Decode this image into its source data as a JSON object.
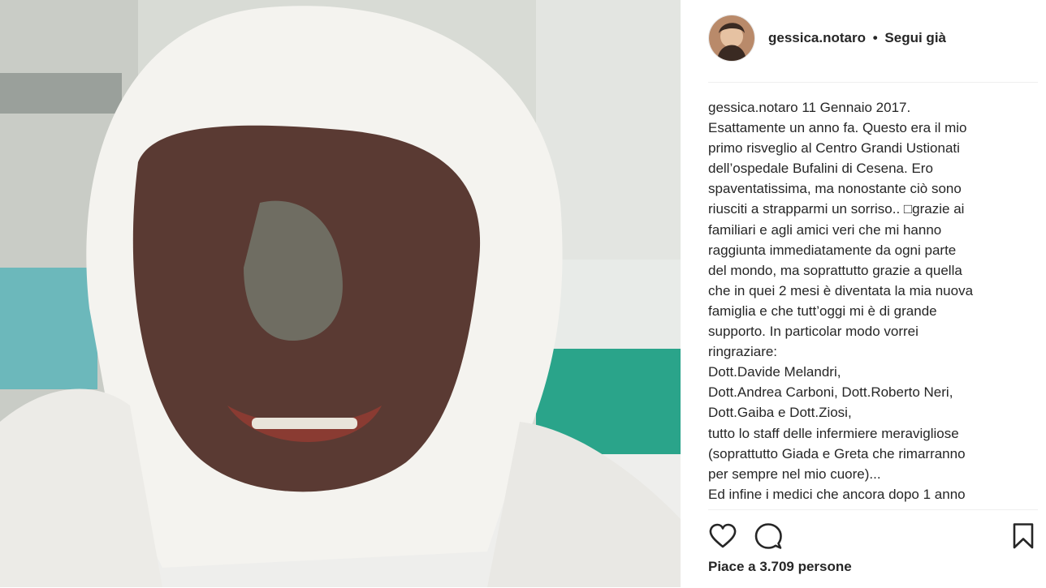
{
  "post": {
    "username": "gessica.notaro",
    "separator": "•",
    "follow_status": "Segui già",
    "caption_first": "11 Gennaio 2017.",
    "caption_lines": [
      "Esattamente un anno fa. Questo era il mio",
      "primo risveglio al Centro Grandi Ustionati",
      "dell’ospedale Bufalini di Cesena. Ero",
      "spaventatissima, ma nonostante ciò sono",
      "riusciti a strapparmi un sorriso.. □grazie ai",
      "familiari e agli amici veri che mi hanno",
      "raggiunta immediatamente da ogni parte",
      "del mondo, ma soprattutto grazie a quella",
      "che in quei 2 mesi è diventata la mia nuova",
      "famiglia e che tutt’oggi mi è di grande",
      "supporto. In particolar modo vorrei",
      "ringraziare:",
      "Dott.Davide Melandri,",
      "Dott.Andrea Carboni, Dott.Roberto Neri,",
      "Dott.Gaiba e Dott.Ziosi,",
      "tutto lo staff delle infermiere meravigliose",
      "(soprattutto Giada e Greta che rimarranno",
      "per sempre nel mio cuore)...",
      "Ed infine i medici che ancora dopo 1 anno"
    ],
    "likes_text": "Piace a 3.709 persone"
  },
  "icons": {
    "like": "heart-outline-icon",
    "comment": "comment-bubble-icon",
    "save": "bookmark-outline-icon"
  }
}
